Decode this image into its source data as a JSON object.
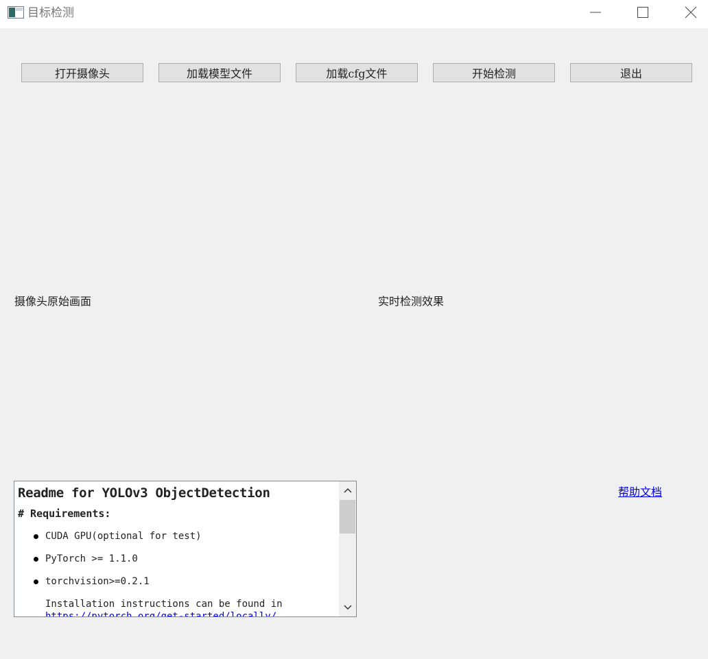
{
  "window": {
    "title": "目标检测",
    "icon": "app-window-icon",
    "controls": [
      "minimize-icon",
      "maximize-icon",
      "close-icon"
    ]
  },
  "toolbar": {
    "open_camera": "打开摄像头",
    "load_model": "加载模型文件",
    "load_cfg": "加载cfg文件",
    "start_detect": "开始检测",
    "exit": "退出"
  },
  "panels": {
    "raw_label": "摄像头原始画面",
    "detect_label": "实时检测效果"
  },
  "help": {
    "label": "帮助文档"
  },
  "readme": {
    "title": "Readme for YOLOv3 ObjectDetection",
    "heading": "# Requirements:",
    "items": [
      "CUDA GPU(optional for test)",
      "PyTorch >= 1.1.0",
      "torchvision>=0.2.1"
    ],
    "paragraph": "Installation instructions can be found in",
    "link": "https://pytorch.org/get-started/locally/"
  },
  "colors": {
    "window_bg": "#f0f0f0",
    "button_bg": "#e1e1e1",
    "button_border": "#adadad",
    "link": "#0000ee"
  }
}
